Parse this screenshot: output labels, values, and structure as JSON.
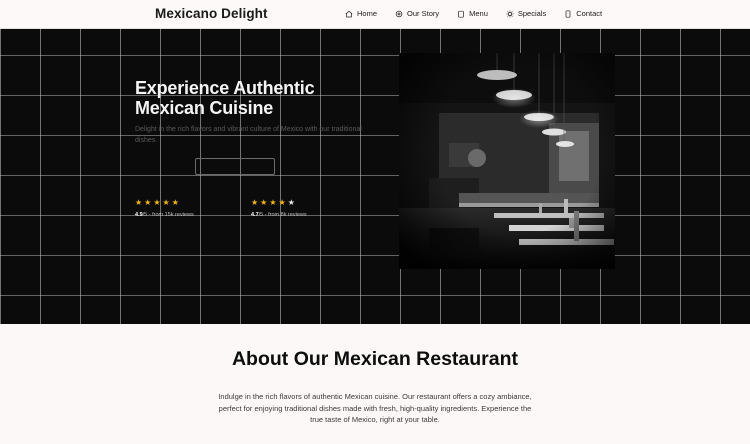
{
  "brand": {
    "name": "Mexicano Delight"
  },
  "nav": {
    "items": [
      {
        "label": "Home",
        "icon": "home-icon"
      },
      {
        "label": "Our Story",
        "icon": "sparkle-icon"
      },
      {
        "label": "Menu",
        "icon": "clipboard-icon"
      },
      {
        "label": "Specials",
        "icon": "sun-icon"
      },
      {
        "label": "Contact",
        "icon": "phone-icon"
      }
    ]
  },
  "hero": {
    "title": "Experience Authentic Mexican Cuisine",
    "subtitle": "Delight in the rich flavors and vibrant culture of Mexico with our traditional dishes.",
    "primary_cta": "",
    "secondary_cta": "",
    "ratings": [
      {
        "score": "4.9",
        "suffix": "/5 - from 15k reviews",
        "stars_filled": 5,
        "stars_total": 5
      },
      {
        "score": "4.7",
        "suffix": "/5 - from 8k reviews",
        "stars_filled": 4,
        "stars_total": 5
      }
    ],
    "photo_alt": "Restaurant interior"
  },
  "about": {
    "title": "About Our Mexican Restaurant",
    "text": "Indulge in the rich flavors of authentic Mexican cuisine. Our restaurant offers a cozy ambiance, perfect for enjoying traditional dishes made with fresh, high-quality ingredients. Experience the true taste of Mexico, right at your table."
  },
  "colors": {
    "star": "#f5b800",
    "hero_bg": "#0b0b0b",
    "page_bg": "#fcf8f7"
  }
}
